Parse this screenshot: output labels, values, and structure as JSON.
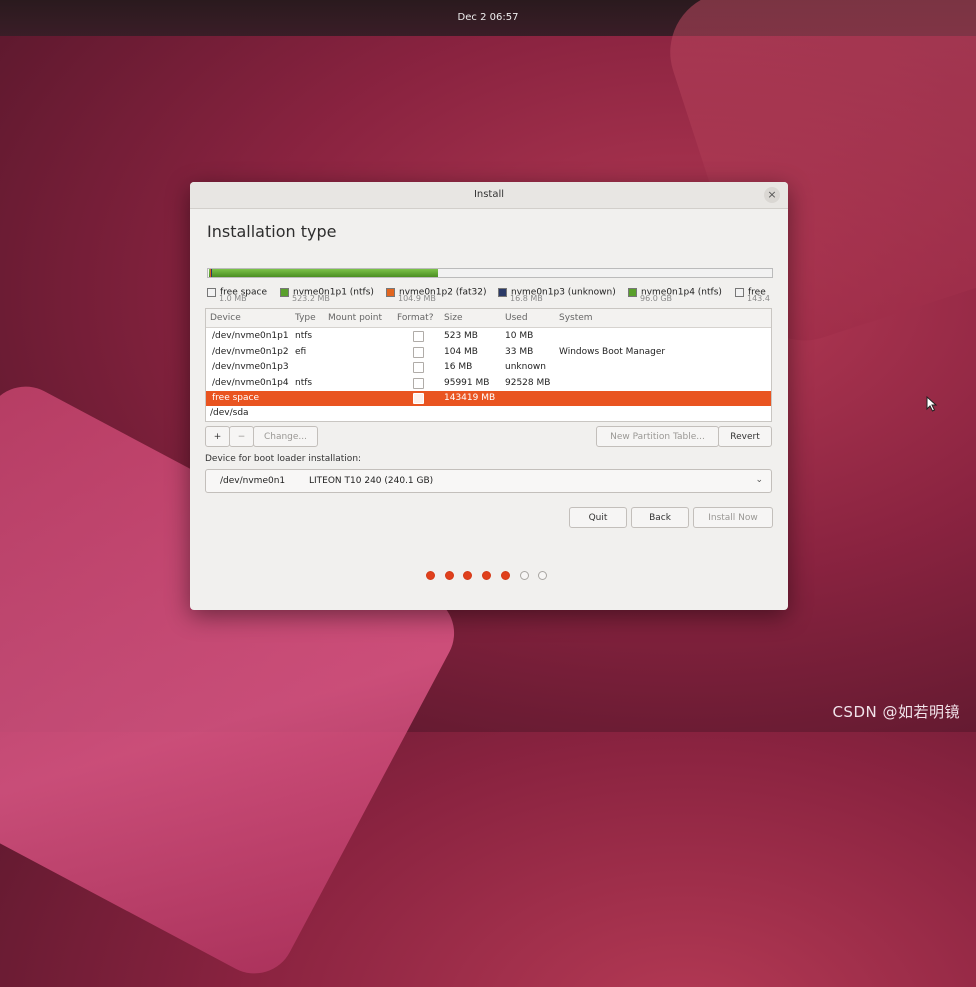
{
  "topbar": {
    "clock": "Dec 2  06:57"
  },
  "watermark": "CSDN @如若明镜",
  "dialog": {
    "title": "Install",
    "close_icon": "×",
    "heading": "Installation type"
  },
  "colors": {
    "accent": "#e95420",
    "ntfs_green": "#5aa02c",
    "fat32_orange": "#e1651f",
    "unknown_navy": "#2b3a67",
    "free_space": "#f2f2f2"
  },
  "usage_bar": {
    "segments": [
      {
        "part": "free space",
        "size_mb": 1.0,
        "color": "#f2f2f2"
      },
      {
        "part": "nvme0n1p1",
        "size_mb": 523.2,
        "color": "#5aa02c"
      },
      {
        "part": "nvme0n1p2",
        "size_mb": 104.9,
        "color": "#e1651f"
      },
      {
        "part": "nvme0n1p3",
        "size_mb": 16.8,
        "color": "#2b3a67"
      },
      {
        "part": "nvme0n1p4",
        "size_mb": 96000,
        "color": "#5aa02c"
      },
      {
        "part": "free",
        "size_mb": 143400,
        "color": "#f2f2f2"
      }
    ]
  },
  "legend": [
    {
      "name": "free space",
      "size": "1.0 MB",
      "color": "#f2f2f2"
    },
    {
      "name": "nvme0n1p1 (ntfs)",
      "size": "523.2 MB",
      "color": "#5aa02c"
    },
    {
      "name": "nvme0n1p2 (fat32)",
      "size": "104.9 MB",
      "color": "#e1651f"
    },
    {
      "name": "nvme0n1p3 (unknown)",
      "size": "16.8 MB",
      "color": "#2b3a67"
    },
    {
      "name": "nvme0n1p4 (ntfs)",
      "size": "96.0 GB",
      "color": "#5aa02c"
    },
    {
      "name": "free",
      "size": "143.4",
      "color": "#f2f2f2"
    }
  ],
  "table": {
    "headers": {
      "device": "Device",
      "type": "Type",
      "mount": "Mount point",
      "format": "Format?",
      "size": "Size",
      "used": "Used",
      "system": "System"
    },
    "rows": [
      {
        "device": "/dev/nvme0n1p1",
        "type": "ntfs",
        "mount": "",
        "size": "523 MB",
        "used": "10 MB",
        "system": ""
      },
      {
        "device": "/dev/nvme0n1p2",
        "type": "efi",
        "mount": "",
        "size": "104 MB",
        "used": "33 MB",
        "system": "Windows Boot Manager"
      },
      {
        "device": "/dev/nvme0n1p3",
        "type": "",
        "mount": "",
        "size": "16 MB",
        "used": "unknown",
        "system": ""
      },
      {
        "device": "/dev/nvme0n1p4",
        "type": "ntfs",
        "mount": "",
        "size": "95991 MB",
        "used": "92528 MB",
        "system": ""
      },
      {
        "device": "free space",
        "type": "",
        "mount": "",
        "size": "143419 MB",
        "used": "",
        "system": ""
      }
    ],
    "selected_row": 4,
    "next_device": "/dev/sda"
  },
  "buttons": {
    "add": "+",
    "remove": "−",
    "change": "Change...",
    "new_partition_table": "New Partition Table...",
    "revert": "Revert",
    "quit": "Quit",
    "back": "Back",
    "install_now": "Install Now"
  },
  "bootloader": {
    "label": "Device for boot loader installation:",
    "device": "/dev/nvme0n1",
    "model": "LITEON T10 240 (240.1 GB)",
    "chevron_icon": "⌄"
  },
  "progress": {
    "total_steps": 7,
    "completed_steps": 5
  }
}
